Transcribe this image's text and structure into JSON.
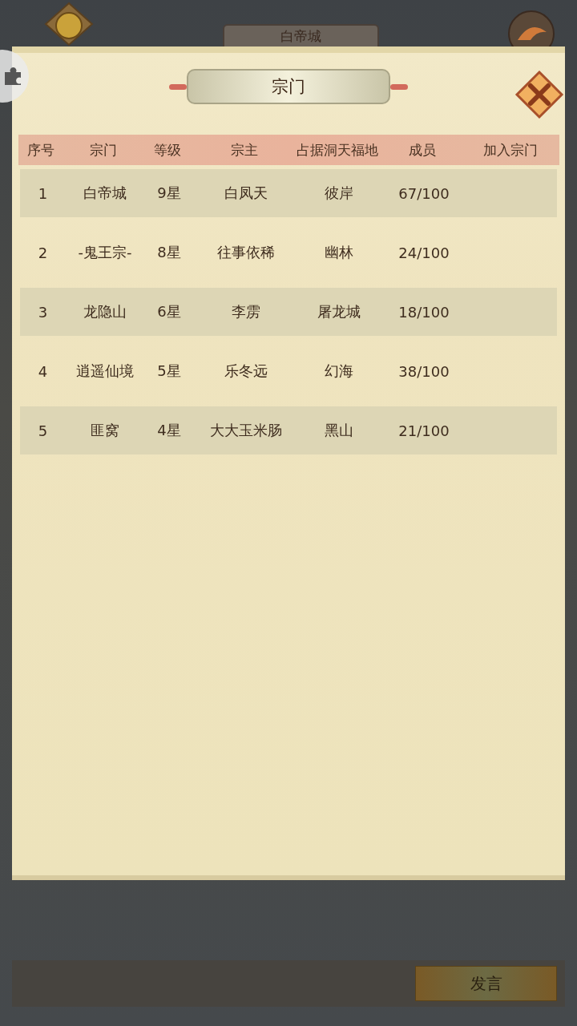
{
  "location_title": "白帝城",
  "panel": {
    "title": "宗门"
  },
  "table": {
    "columns": [
      "序号",
      "宗门",
      "等级",
      "宗主",
      "占据洞天福地",
      "成员",
      "加入宗门"
    ],
    "rows": [
      {
        "cells": [
          "1",
          "白帝城",
          "9星",
          "白凤天",
          "彼岸",
          "67/100"
        ]
      },
      {
        "cells": [
          "2",
          "-鬼王宗-",
          "8星",
          "往事依稀",
          "幽林",
          "24/100"
        ]
      },
      {
        "cells": [
          "3",
          "龙隐山",
          "6星",
          "李雳",
          "屠龙城",
          "18/100"
        ]
      },
      {
        "cells": [
          "4",
          "逍遥仙境",
          "5星",
          "乐冬远",
          "幻海",
          "38/100"
        ]
      },
      {
        "cells": [
          "5",
          "匪窝",
          "4星",
          "大大玉米肠",
          "黑山",
          "21/100"
        ]
      }
    ]
  },
  "chat": {
    "send_button": "发言"
  }
}
